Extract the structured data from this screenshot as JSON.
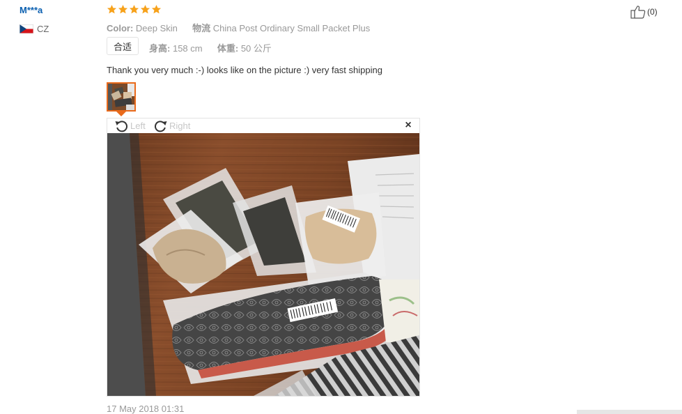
{
  "reviewer": {
    "name": "M***a",
    "country_code": "CZ"
  },
  "rating": {
    "stars": 5,
    "max": 5,
    "color": "#f7a21b"
  },
  "attributes": {
    "color_label": "Color:",
    "color_value": "Deep Skin",
    "shipping_label": "物流",
    "shipping_value": "China Post Ordinary Small Packet Plus"
  },
  "fit": {
    "button_label": "合适"
  },
  "body": {
    "height_label": "身高:",
    "height_value": "158 cm",
    "weight_label": "体重:",
    "weight_value": "50 公斤"
  },
  "review": {
    "text": "Thank you very much :-) looks like on the picture :) very fast shipping",
    "date": "17 May 2018 01:31"
  },
  "viewer": {
    "rotate_left_label": "Left",
    "rotate_right_label": "Right",
    "close_label": "×",
    "accent_color": "#e96a1b"
  },
  "helpful": {
    "count_label": "(0)"
  }
}
